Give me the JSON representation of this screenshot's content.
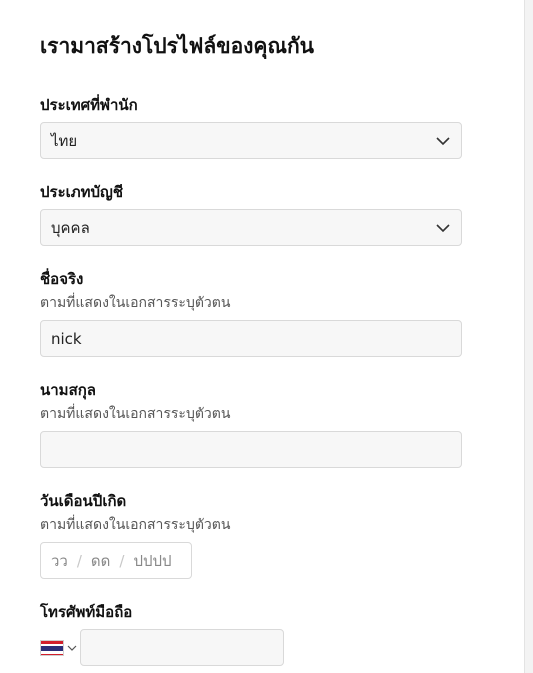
{
  "title": "เรามาสร้างโปรไฟล์ของคุณกัน",
  "fields": {
    "country": {
      "label": "ประเทศที่พำนัก",
      "value": "ไทย"
    },
    "account_type": {
      "label": "ประเภทบัญชี",
      "value": "บุคคล"
    },
    "first_name": {
      "label": "ชื่อจริง",
      "hint": "ตามที่แสดงในเอกสารระบุตัวตน",
      "value": "nick"
    },
    "last_name": {
      "label": "นามสกุล",
      "hint": "ตามที่แสดงในเอกสารระบุตัวตน",
      "value": ""
    },
    "dob": {
      "label": "วันเดือนปีเกิด",
      "hint": "ตามที่แสดงในเอกสารระบุตัวตน",
      "day_placeholder": "วว",
      "month_placeholder": "ดด",
      "year_placeholder": "ปปปป",
      "separator": "/"
    },
    "phone": {
      "label": "โทรศัพท์มือถือ",
      "country_flag": "thailand-flag-icon",
      "value": ""
    }
  },
  "colors": {
    "field_bg": "#f7f7f7",
    "field_border": "#d9d9d9",
    "hint": "#555555"
  }
}
